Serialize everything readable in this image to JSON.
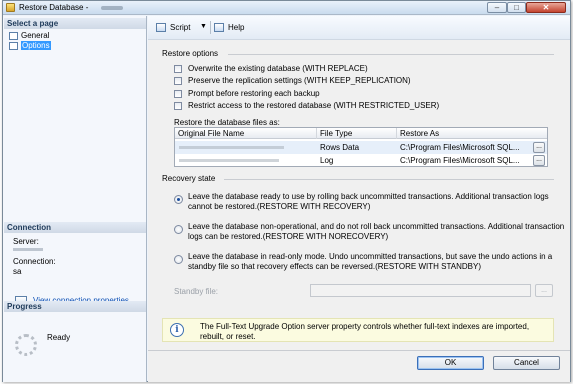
{
  "window": {
    "title": "Restore Database -",
    "min_glyph": "–",
    "max_glyph": "□",
    "close_glyph": "✕"
  },
  "left_panel": {
    "select_page_header": "Select a page",
    "pages": [
      {
        "label": "General",
        "icon": "page-icon"
      },
      {
        "label": "Options",
        "icon": "page-icon",
        "selected": true
      }
    ],
    "connection_header": "Connection",
    "server_label": "Server:",
    "connection_label": "Connection:",
    "connection_value": "sa",
    "view_connection_link": "View connection properties",
    "progress_header": "Progress",
    "progress_status": "Ready"
  },
  "toolbar": {
    "script_label": "Script",
    "script_arrow": "▼",
    "help_label": "Help"
  },
  "restore_options": {
    "group_label": "Restore options",
    "checkboxes": [
      {
        "label": "Overwrite the existing database (WITH REPLACE)",
        "checked": false
      },
      {
        "label": "Preserve the replication settings (WITH KEEP_REPLICATION)",
        "checked": false
      },
      {
        "label": "Prompt before restoring each backup",
        "checked": false
      },
      {
        "label": "Restrict access to the restored database (WITH RESTRICTED_USER)",
        "checked": false
      }
    ]
  },
  "files": {
    "label": "Restore the database files as:",
    "columns": [
      "Original File Name",
      "File Type",
      "Restore As"
    ],
    "rows": [
      {
        "original": "",
        "file_type": "Rows Data",
        "restore_as": "C:\\Program Files\\Microsoft SQL...",
        "browse": "..."
      },
      {
        "original": "",
        "file_type": "Log",
        "restore_as": "C:\\Program Files\\Microsoft SQL...",
        "browse": "..."
      }
    ]
  },
  "recovery": {
    "group_label": "Recovery state",
    "options": [
      {
        "text": "Leave the database ready to use by rolling back uncommitted transactions. Additional transaction logs cannot be restored.(RESTORE WITH RECOVERY)",
        "selected": true
      },
      {
        "text": "Leave the database non-operational, and do not roll back uncommitted transactions. Additional transaction logs can be restored.(RESTORE WITH NORECOVERY)",
        "selected": false
      },
      {
        "text": "Leave the database in read-only mode. Undo uncommitted transactions, but save the undo actions in a standby file so that recovery effects can be reversed.(RESTORE WITH STANDBY)",
        "selected": false
      }
    ],
    "standby_label": "Standby file:",
    "standby_value": "",
    "standby_browse": "..."
  },
  "info": {
    "icon": "info-icon",
    "text": "The Full-Text Upgrade Option server property controls whether full-text indexes are imported, rebuilt, or reset."
  },
  "buttons": {
    "ok": "OK",
    "cancel": "Cancel"
  }
}
